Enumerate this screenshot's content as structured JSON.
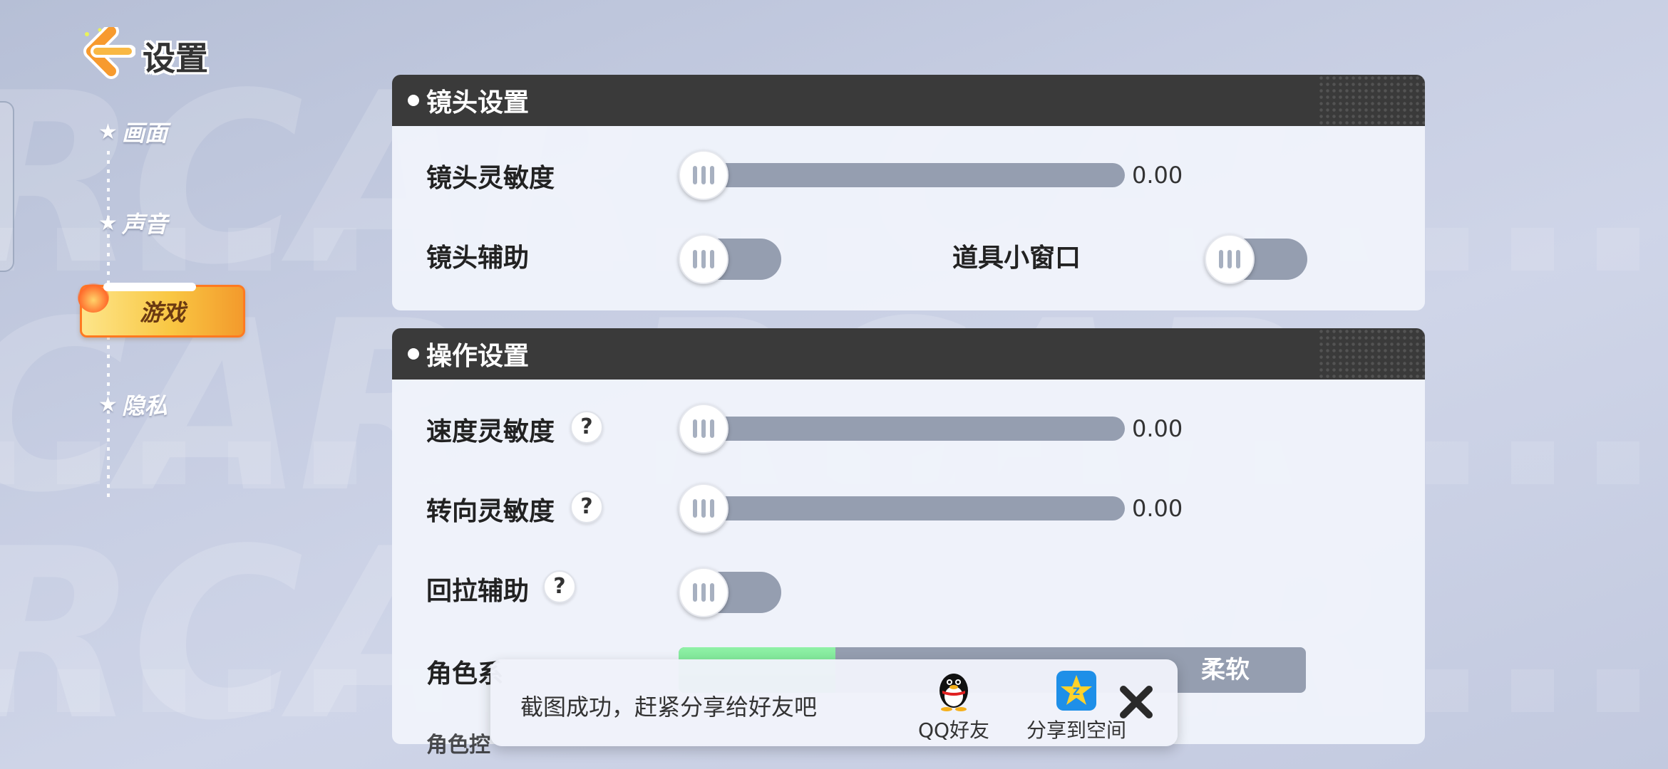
{
  "header": {
    "title": "设置"
  },
  "nav": {
    "items": [
      {
        "label": "画面",
        "active": false
      },
      {
        "label": "声音",
        "active": false
      },
      {
        "label": "游戏",
        "active": true
      },
      {
        "label": "隐私",
        "active": false
      }
    ]
  },
  "camera": {
    "title": "镜头设置",
    "sensitivity": {
      "label": "镜头灵敏度",
      "value": "0.00"
    },
    "assist": {
      "label": "镜头辅助",
      "on": false
    },
    "item_window": {
      "label": "道具小窗口",
      "on": false
    }
  },
  "controls": {
    "title": "操作设置",
    "speed": {
      "label": "速度灵敏度",
      "value": "0.00",
      "help": "?"
    },
    "steer": {
      "label": "转向灵敏度",
      "value": "0.00",
      "help": "?"
    },
    "pullback": {
      "label": "回拉辅助",
      "help": "?",
      "on": false
    },
    "role": {
      "label": "角色柔软度",
      "visible_label": "角色系",
      "option_right": "柔软"
    },
    "next_label_partial": "角色控"
  },
  "toast": {
    "message": "截图成功，赶紧分享给好友吧",
    "qq_label": "QQ好友",
    "qzone_label": "分享到空间"
  },
  "colors": {
    "accent_orange": "#ff7a21",
    "panel_header": "#3a3a3a",
    "track": "#959eb0",
    "segment_selected": "#5fdc7e"
  }
}
